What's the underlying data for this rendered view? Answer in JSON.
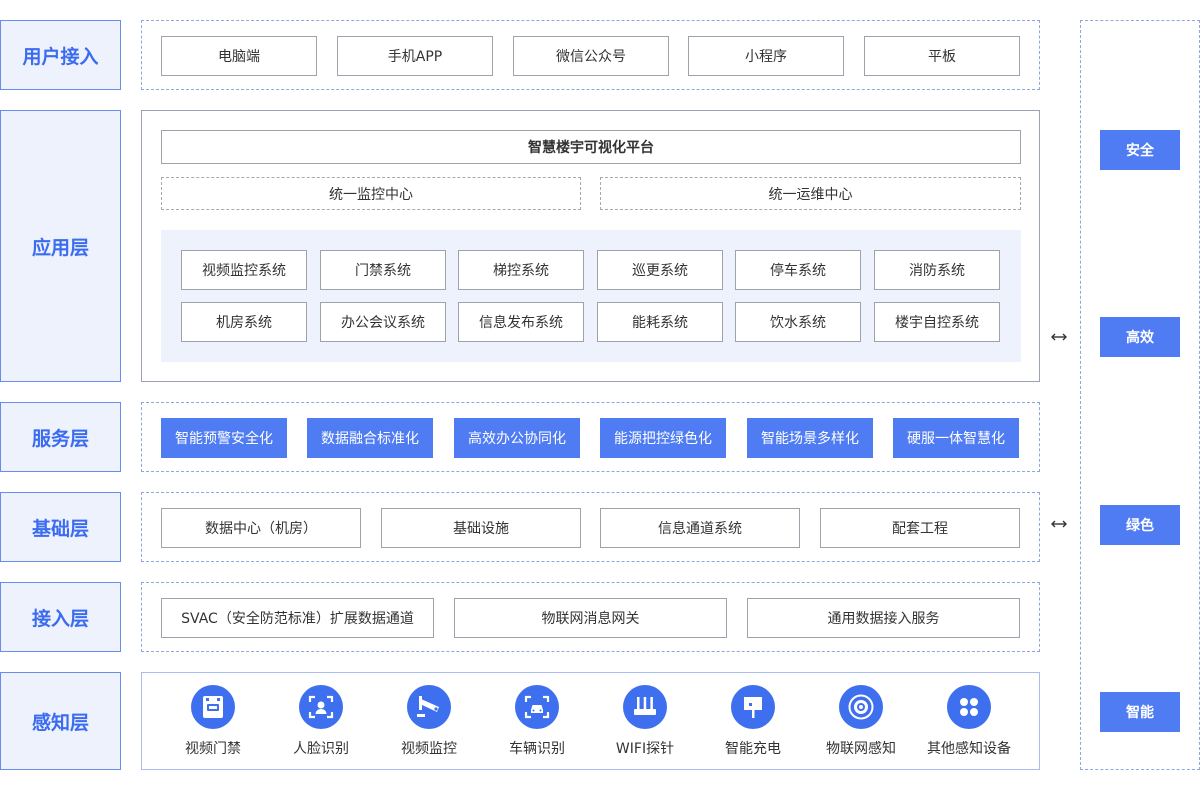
{
  "layers": {
    "user_access": "用户接入",
    "application": "应用层",
    "service": "服务层",
    "foundation": "基础层",
    "access": "接入层",
    "perception": "感知层"
  },
  "user_access": [
    "电脑端",
    "手机APP",
    "微信公众号",
    "小程序",
    "平板"
  ],
  "application": {
    "platform": "智慧楼宇可视化平台",
    "centers": [
      "统一监控中心",
      "统一运维中心"
    ],
    "systems_row1": [
      "视频监控系统",
      "门禁系统",
      "梯控系统",
      "巡更系统",
      "停车系统",
      "消防系统"
    ],
    "systems_row2": [
      "机房系统",
      "办公会议系统",
      "信息发布系统",
      "能耗系统",
      "饮水系统",
      "楼宇自控系统"
    ]
  },
  "service": [
    "智能预警安全化",
    "数据融合标准化",
    "高效办公协同化",
    "能源把控绿色化",
    "智能场景多样化",
    "硬服一体智慧化"
  ],
  "foundation": [
    "数据中心（机房）",
    "基础设施",
    "信息通道系统",
    "配套工程"
  ],
  "access": [
    "SVAC（安全防范标准）扩展数据通道",
    "物联网消息网关",
    "通用数据接入服务"
  ],
  "perception": [
    {
      "label": "视频门禁",
      "icon": "door-access-icon"
    },
    {
      "label": "人脸识别",
      "icon": "face-recognition-icon"
    },
    {
      "label": "视频监控",
      "icon": "cctv-camera-icon"
    },
    {
      "label": "车辆识别",
      "icon": "vehicle-recognition-icon"
    },
    {
      "label": "WIFI探针",
      "icon": "wifi-router-icon"
    },
    {
      "label": "智能充电",
      "icon": "charging-sign-icon"
    },
    {
      "label": "物联网感知",
      "icon": "iot-sensor-icon"
    },
    {
      "label": "其他感知设备",
      "icon": "other-devices-icon"
    }
  ],
  "side": [
    "安全",
    "高效",
    "绿色",
    "智能"
  ],
  "colors": {
    "accent": "#4f7cf3",
    "label_text": "#3b6cf0",
    "label_bg": "#eef2fd"
  }
}
